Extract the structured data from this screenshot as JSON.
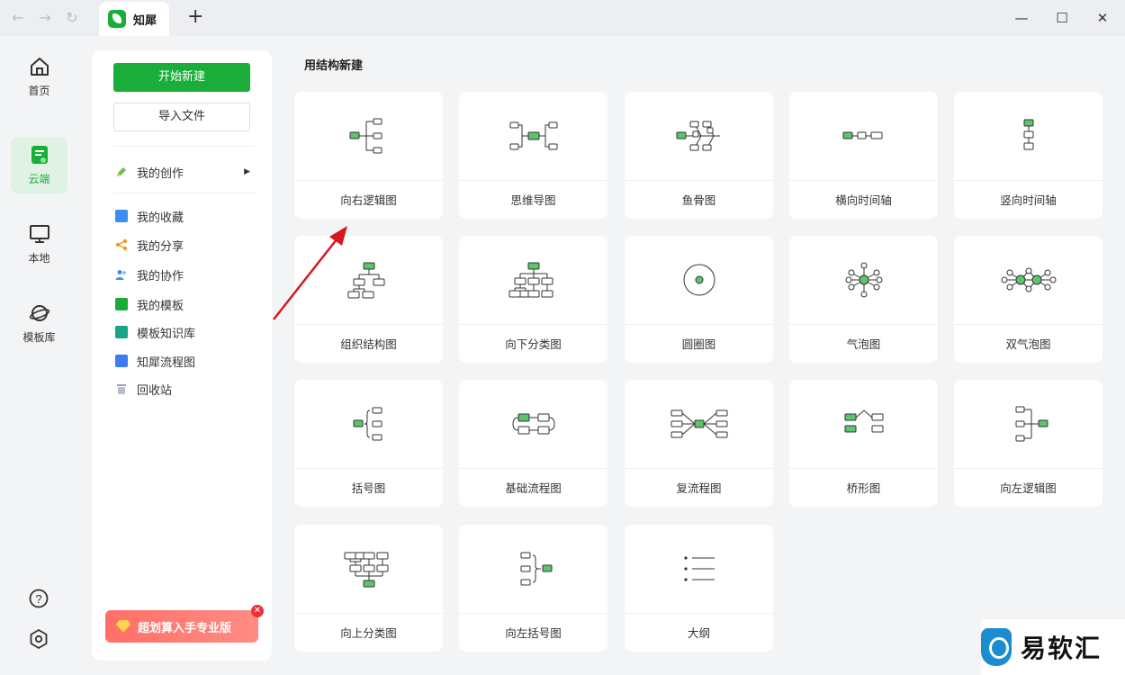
{
  "titlebar": {
    "tab_title": "知犀",
    "new_tab": "+",
    "back": "←",
    "forward": "→",
    "refresh": "↻",
    "minimize": "—",
    "maximize": "☐",
    "close": "✕"
  },
  "rail": {
    "items": [
      {
        "label": "首页",
        "icon": "home-icon"
      },
      {
        "label": "云端",
        "icon": "cloud-doc-icon"
      },
      {
        "label": "本地",
        "icon": "monitor-icon"
      },
      {
        "label": "模板库",
        "icon": "planet-icon"
      }
    ],
    "help": "?",
    "settings": "settings-icon",
    "active_color": "#1aad3a"
  },
  "sidebar": {
    "new_button": "开始新建",
    "import_button": "导入文件",
    "my_creation": "我的创作",
    "items": [
      {
        "label": "我的收藏",
        "color": "#3d8ef0"
      },
      {
        "label": "我的分享",
        "color": "#f59a23"
      },
      {
        "label": "我的协作",
        "color": "#3d8ef0"
      },
      {
        "label": "我的模板",
        "color": "#1aad3a"
      },
      {
        "label": "模板知识库",
        "color": "#17a58a"
      },
      {
        "label": "知犀流程图",
        "color": "#3d7bf0"
      },
      {
        "label": "回收站",
        "color": "#9aa3b5"
      }
    ],
    "promo": "超划算入手专业版"
  },
  "main": {
    "section_title": "用结构新建",
    "cards": [
      {
        "label": "向右逻辑图",
        "icon": "right-logic-icon"
      },
      {
        "label": "思维导图",
        "icon": "mindmap-icon"
      },
      {
        "label": "鱼骨图",
        "icon": "fishbone-icon"
      },
      {
        "label": "横向时间轴",
        "icon": "horizontal-timeline-icon"
      },
      {
        "label": "竖向时间轴",
        "icon": "vertical-timeline-icon"
      },
      {
        "label": "组织结构图",
        "icon": "org-chart-icon"
      },
      {
        "label": "向下分类图",
        "icon": "down-tree-icon"
      },
      {
        "label": "圆圈图",
        "icon": "circle-map-icon"
      },
      {
        "label": "气泡图",
        "icon": "bubble-map-icon"
      },
      {
        "label": "双气泡图",
        "icon": "double-bubble-icon"
      },
      {
        "label": "括号图",
        "icon": "brace-map-icon"
      },
      {
        "label": "基础流程图",
        "icon": "flow-map-icon"
      },
      {
        "label": "复流程图",
        "icon": "multi-flow-icon"
      },
      {
        "label": "桥形图",
        "icon": "bridge-map-icon"
      },
      {
        "label": "向左逻辑图",
        "icon": "left-logic-icon"
      },
      {
        "label": "向上分类图",
        "icon": "up-tree-icon"
      },
      {
        "label": "向左括号图",
        "icon": "left-brace-icon"
      },
      {
        "label": "大纲",
        "icon": "outline-icon"
      }
    ]
  },
  "watermark": "易软汇"
}
